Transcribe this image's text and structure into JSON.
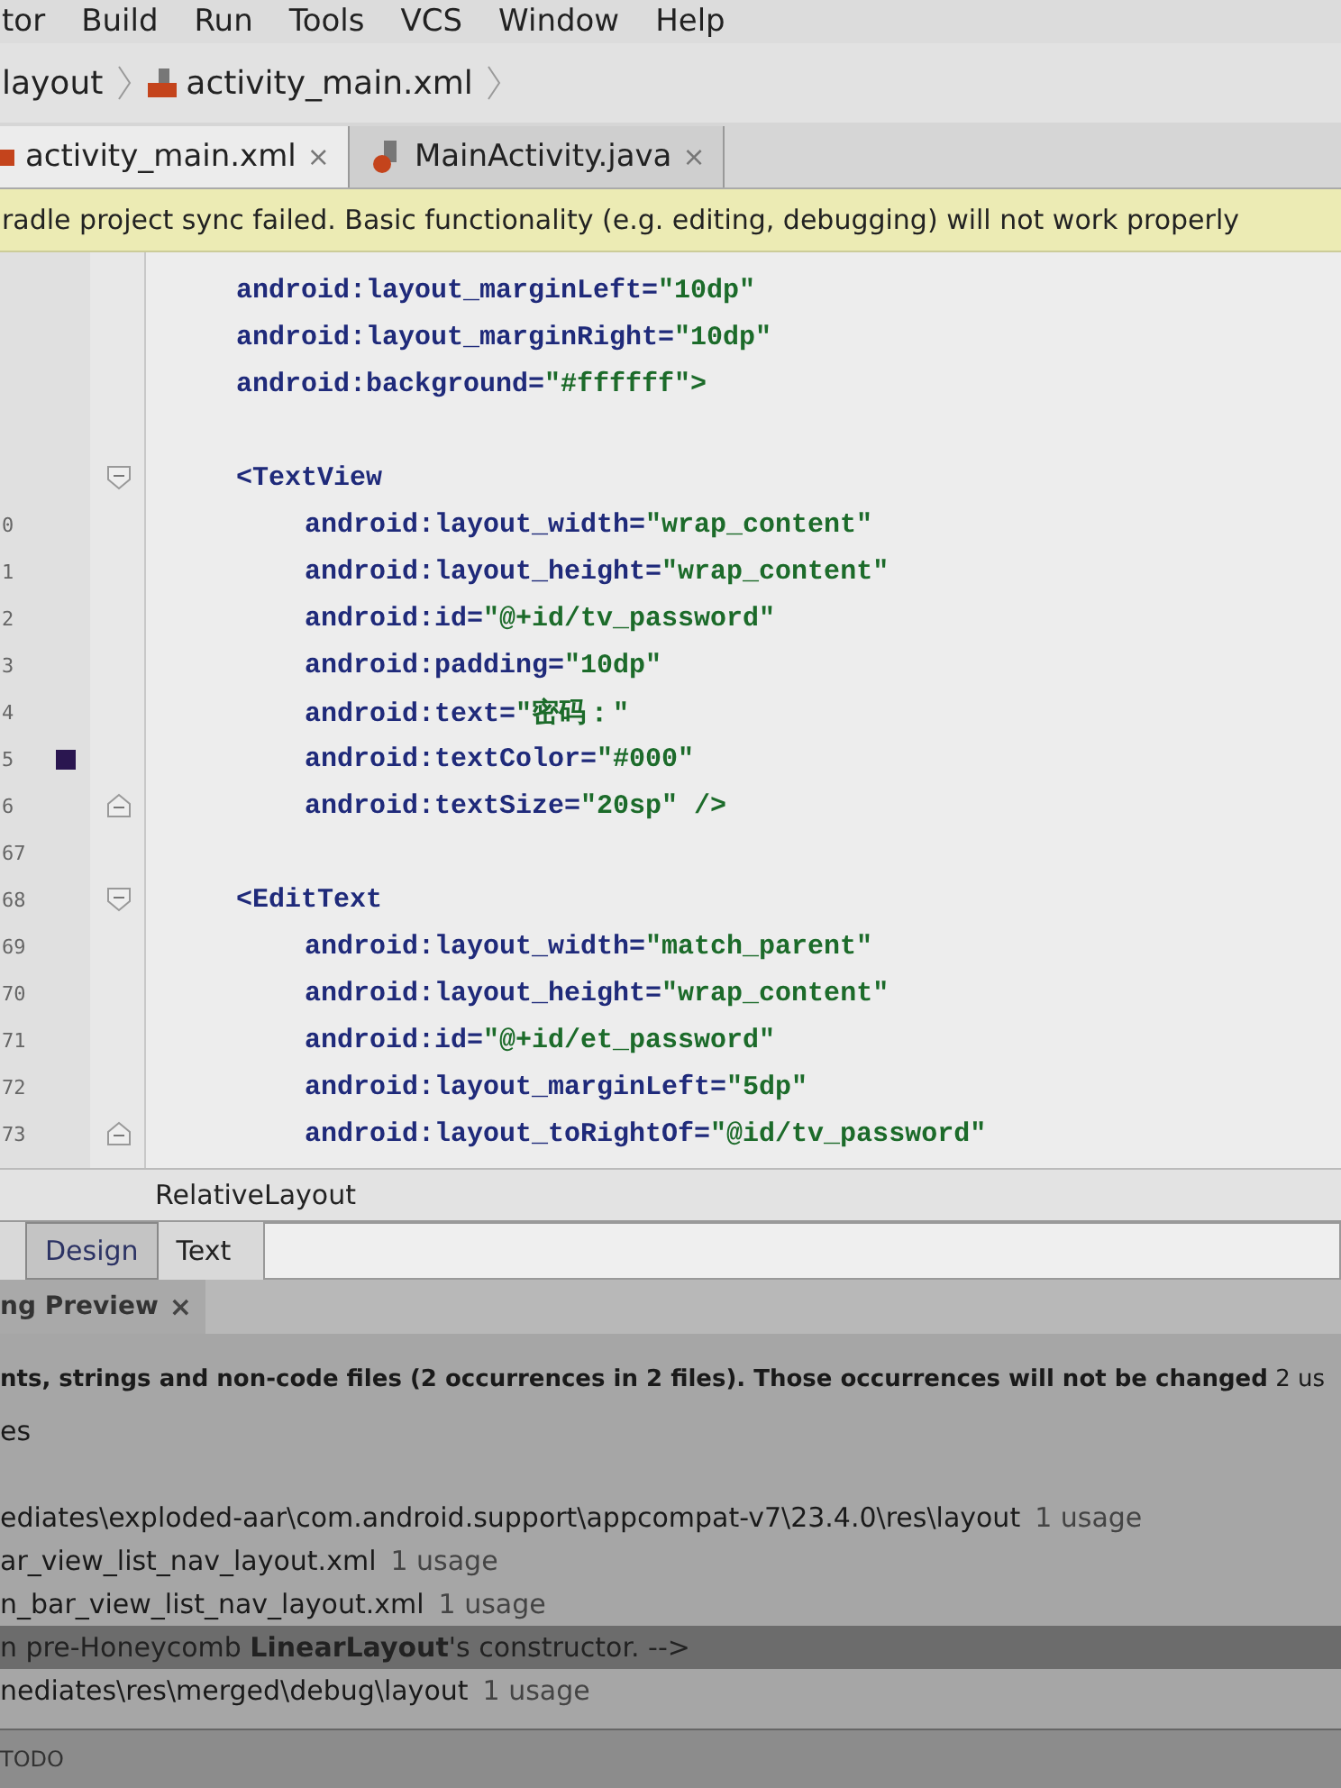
{
  "menu": [
    "tor",
    "Build",
    "Run",
    "Tools",
    "VCS",
    "Window",
    "Help"
  ],
  "breadcrumb": [
    "layout",
    "activity_main.xml"
  ],
  "tabs": [
    {
      "label": "activity_main.xml",
      "kind": "xml",
      "close": "×",
      "selected": true
    },
    {
      "label": "MainActivity.java",
      "kind": "java",
      "close": "×",
      "selected": false
    }
  ],
  "warning": "radle project sync failed. Basic functionality (e.g. editing, debugging) will not work properly",
  "code": [
    {
      "kind": "attr",
      "name": "android:layout_marginLeft=",
      "value": "\"10dp\""
    },
    {
      "kind": "attr",
      "name": "android:layout_marginRight=",
      "value": "\"10dp\""
    },
    {
      "kind": "attr",
      "name": "android:background=",
      "value": "\"#ffffff\">"
    },
    {
      "kind": "blank"
    },
    {
      "kind": "tag",
      "name": "<TextView",
      "children": [
        {
          "number": "0",
          "name": "android:layout_width=",
          "value": "\"wrap_content\"",
          "swatch": false
        },
        {
          "number": "1",
          "name": "android:layout_height=",
          "value": "\"wrap_content\"",
          "swatch": false
        },
        {
          "number": "2",
          "name": "android:id=",
          "value": "\"@+id/tv_password\"",
          "swatch": false
        },
        {
          "number": "3",
          "name": "android:padding=",
          "value": "\"10dp\"",
          "swatch": false
        },
        {
          "number": "4",
          "name": "android:text=",
          "value": "\"密码：\"",
          "swatch": false
        },
        {
          "number": "5",
          "name": "android:textColor=",
          "value": "\"#000\"",
          "swatch": true
        },
        {
          "number": "6",
          "name": "android:textSize=",
          "value": "\"20sp\" />",
          "swatch": false
        }
      ]
    },
    {
      "kind": "blank",
      "number": "67"
    },
    {
      "kind": "tag",
      "number": "68",
      "name": "<EditText",
      "children": [
        {
          "number": "69",
          "name": "android:layout_width=",
          "value": "\"match_parent\"",
          "swatch": false
        },
        {
          "number": "70",
          "name": "android:layout_height=",
          "value": "\"wrap_content\"",
          "swatch": false
        },
        {
          "number": "71",
          "name": "android:id=",
          "value": "\"@+id/et_password\"",
          "swatch": false
        },
        {
          "number": "72",
          "name": "android:layout_marginLeft=",
          "value": "\"5dp\"",
          "swatch": false
        },
        {
          "number": "73",
          "name": "android:layout_toRightOf=",
          "value": "\"@id/tv_password\"",
          "swatch": false
        }
      ]
    }
  ],
  "element_path": "RelativeLayout",
  "editor_tabs": [
    {
      "label": "Design",
      "selected": true
    },
    {
      "label": "Text",
      "selected": false
    }
  ],
  "tool_tab": {
    "label": "ng Preview",
    "close": "×"
  },
  "find": {
    "heading": "**nts, strings and non-code files  (2 occurrences in 2 files). Those occurrences will not be changed** 2 us",
    "rows": [
      {
        "text": "es",
        "highlighted": false
      },
      {
        "highlighted": false
      },
      {
        "text": "ediates\\exploded-aar\\com.android.support\\appcompat-v7\\23.4.0\\res\\layout",
        "count": "1 usage",
        "highlighted": false
      },
      {
        "text": "ar_view_list_nav_layout.xml",
        "count": "1 usage",
        "highlighted": false
      },
      {
        "text": "n_bar_view_list_nav_layout.xml",
        "count": "1 usage",
        "highlighted": false
      },
      {
        "text": "n pre-Honeycomb **LinearLayout**'s constructor. -->",
        "highlighted": true
      },
      {
        "text": "nediates\\res\\merged\\debug\\layout",
        "count": "1 usage",
        "highlighted": false
      }
    ]
  },
  "status": "TODO"
}
